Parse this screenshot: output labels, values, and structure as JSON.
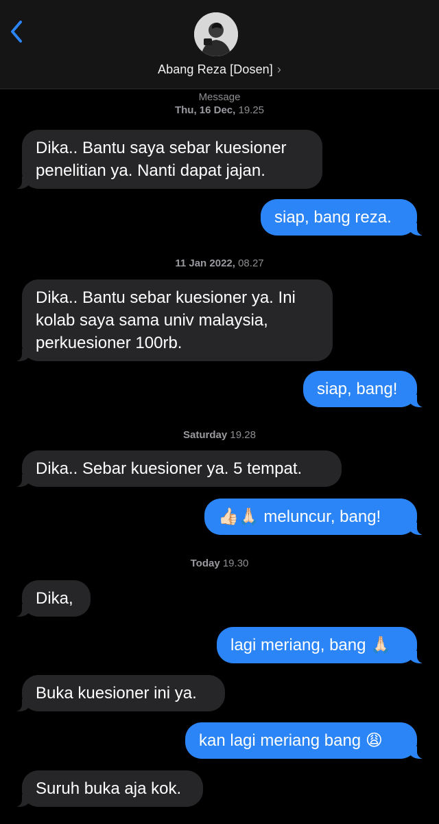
{
  "header": {
    "contact_name": "Abang Reza [Dosen]",
    "chevron": "›",
    "back_icon": "chevron-left-icon",
    "accent_color": "#2b85f6"
  },
  "stamps": {
    "s1_title": "Message",
    "s1_date": "Thu, 16 Dec,",
    "s1_time": " 19.25",
    "s2_date": "11 Jan 2022,",
    "s2_time": " 08.27",
    "s3_date": "Saturday",
    "s3_time": " 19.28",
    "s4_date": "Today",
    "s4_time": " 19.30"
  },
  "messages": [
    {
      "dir": "in",
      "line1": "Dika.. Bantu saya sebar kuesioner",
      "line2": "penelitian ya. Nanti dapat jajan."
    },
    {
      "dir": "out",
      "text": "siap, bang reza."
    },
    {
      "dir": "in",
      "line1": "Dika.. Bantu sebar kuesioner ya. Ini",
      "line2": "kolab saya sama univ malaysia,",
      "line3": "perkuesioner 100rb."
    },
    {
      "dir": "out",
      "text": "siap, bang!"
    },
    {
      "dir": "in",
      "text": "Dika.. Sebar kuesioner ya. 5 tempat."
    },
    {
      "dir": "out",
      "emoji": "👍🏻🙏🏻",
      "text": " meluncur, bang!"
    },
    {
      "dir": "in",
      "text": "Dika,"
    },
    {
      "dir": "out",
      "text": "lagi meriang, bang ",
      "emoji": "🙏🏻"
    },
    {
      "dir": "in",
      "text": "Buka kuesioner ini ya."
    },
    {
      "dir": "out",
      "text": "kan lagi meriang bang ",
      "emoji": "😩"
    },
    {
      "dir": "in",
      "text": "Suruh buka aja kok."
    }
  ]
}
